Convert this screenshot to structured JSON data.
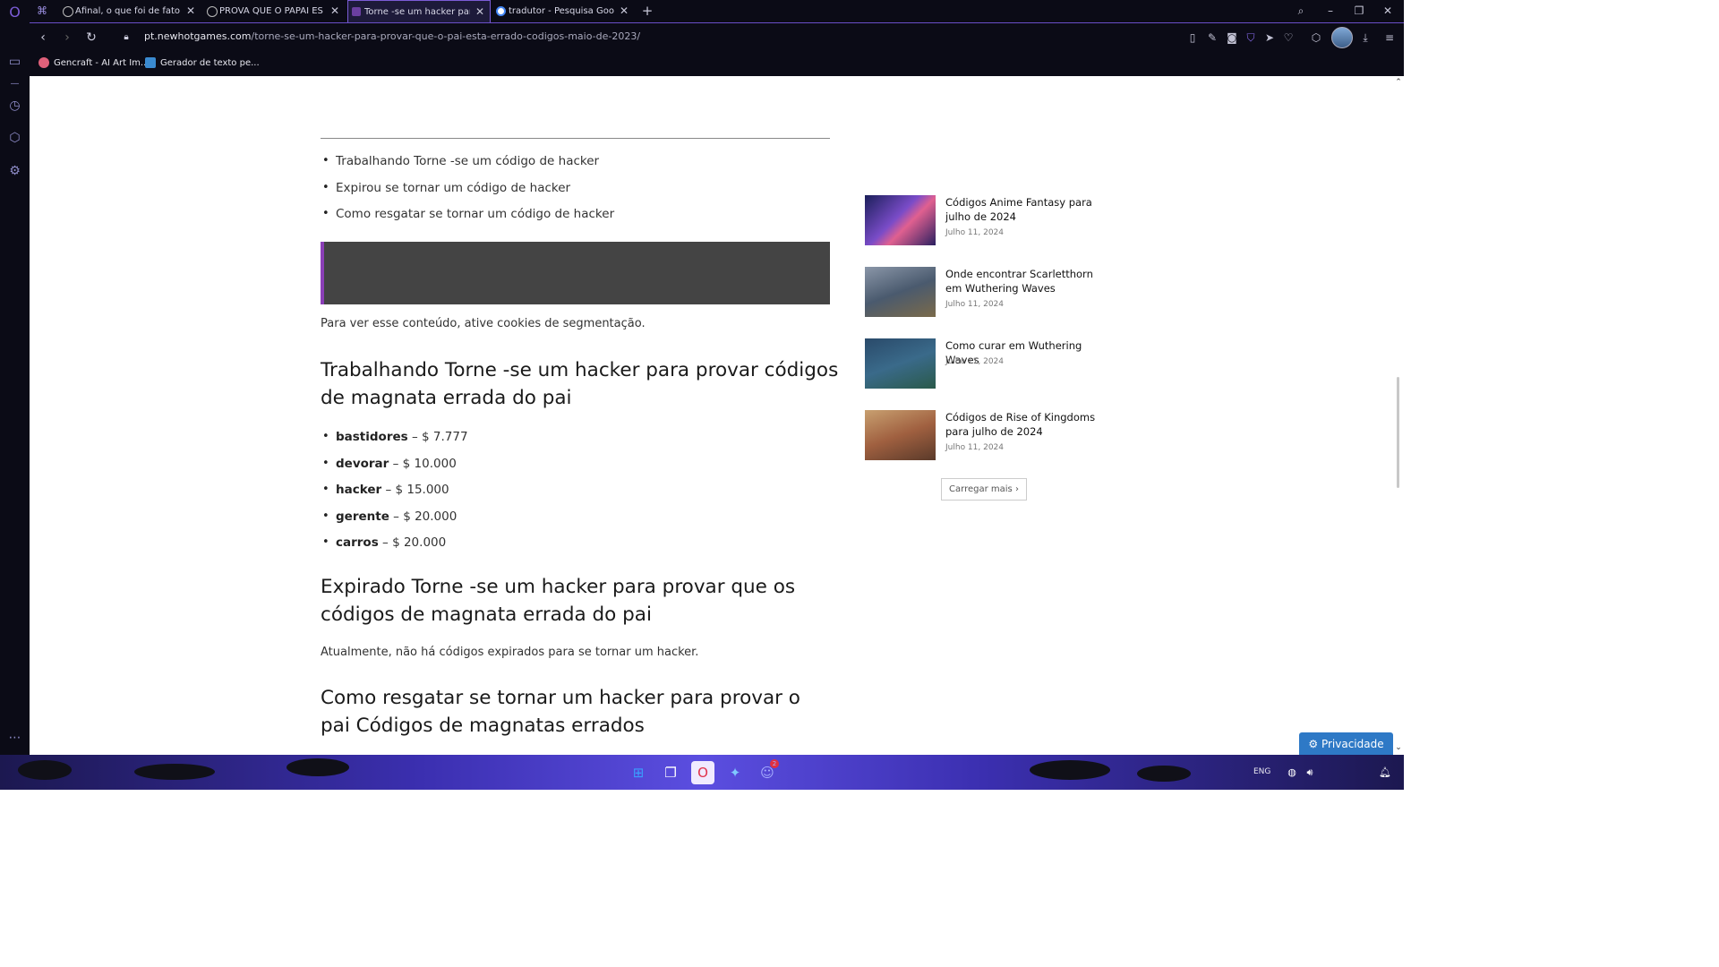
{
  "browser": {
    "tabs": [
      {
        "title": "Afinal, o que foi de fato a B",
        "active": false
      },
      {
        "title": "PROVA QUE O PAPAI ES",
        "active": false
      },
      {
        "title": "Torne -se um hacker para p",
        "active": true
      },
      {
        "title": "tradutor - Pesquisa Google",
        "active": false
      }
    ],
    "new_tab_symbol": "+",
    "address": {
      "domain": "pt.newhotgames.com",
      "path": "/torne-se-um-hacker-para-provar-que-o-pai-esta-errado-codigos-maio-de-2023/"
    },
    "bookmarks": [
      {
        "label": "Gencraft - AI Art Im..."
      },
      {
        "label": "Gerador de texto pe..."
      }
    ],
    "accent_color": "#7b5cd6"
  },
  "article": {
    "toc": [
      "Trabalhando Torne -se um código de hacker",
      "Expirou se tornar um código de hacker",
      "Como resgatar se tornar um código de hacker"
    ],
    "cookie_notice": "Para ver esse conteúdo, ative cookies de segmentação.",
    "heading_working": "Trabalhando Torne -se um hacker para provar códigos de magnata errada do pai",
    "codes": [
      {
        "code": "bastidores",
        "reward": "– $ 7.777"
      },
      {
        "code": "devorar",
        "reward": "– $ 10.000"
      },
      {
        "code": "hacker",
        "reward": "– $ 15.000"
      },
      {
        "code": "gerente",
        "reward": "– $ 20.000"
      },
      {
        "code": "carros",
        "reward": "– $ 20.000"
      }
    ],
    "heading_expired": "Expirado Torne -se um hacker para provar que os códigos de magnata errada do pai",
    "expired_text": "Atualmente, não há códigos expirados para se tornar um hacker.",
    "heading_redeem": "Como resgatar se tornar um hacker para provar o pai Códigos de magnatas errados"
  },
  "sidebar": {
    "posts": [
      {
        "title": "Códigos Anime Fantasy para julho de 2024",
        "date": "Julho 11, 2024"
      },
      {
        "title": "Onde encontrar Scarletthorn em Wuthering Waves",
        "date": "Julho 11, 2024"
      },
      {
        "title": "Como curar em Wuthering Waves",
        "date": "Julho 11, 2024"
      },
      {
        "title": "Códigos de Rise of Kingdoms para julho de 2024",
        "date": "Julho 11, 2024"
      }
    ],
    "load_more": "Carregar mais"
  },
  "privacy_button": "Privacidade",
  "taskbar": {
    "language": "ENG",
    "discord_badge": "2"
  }
}
